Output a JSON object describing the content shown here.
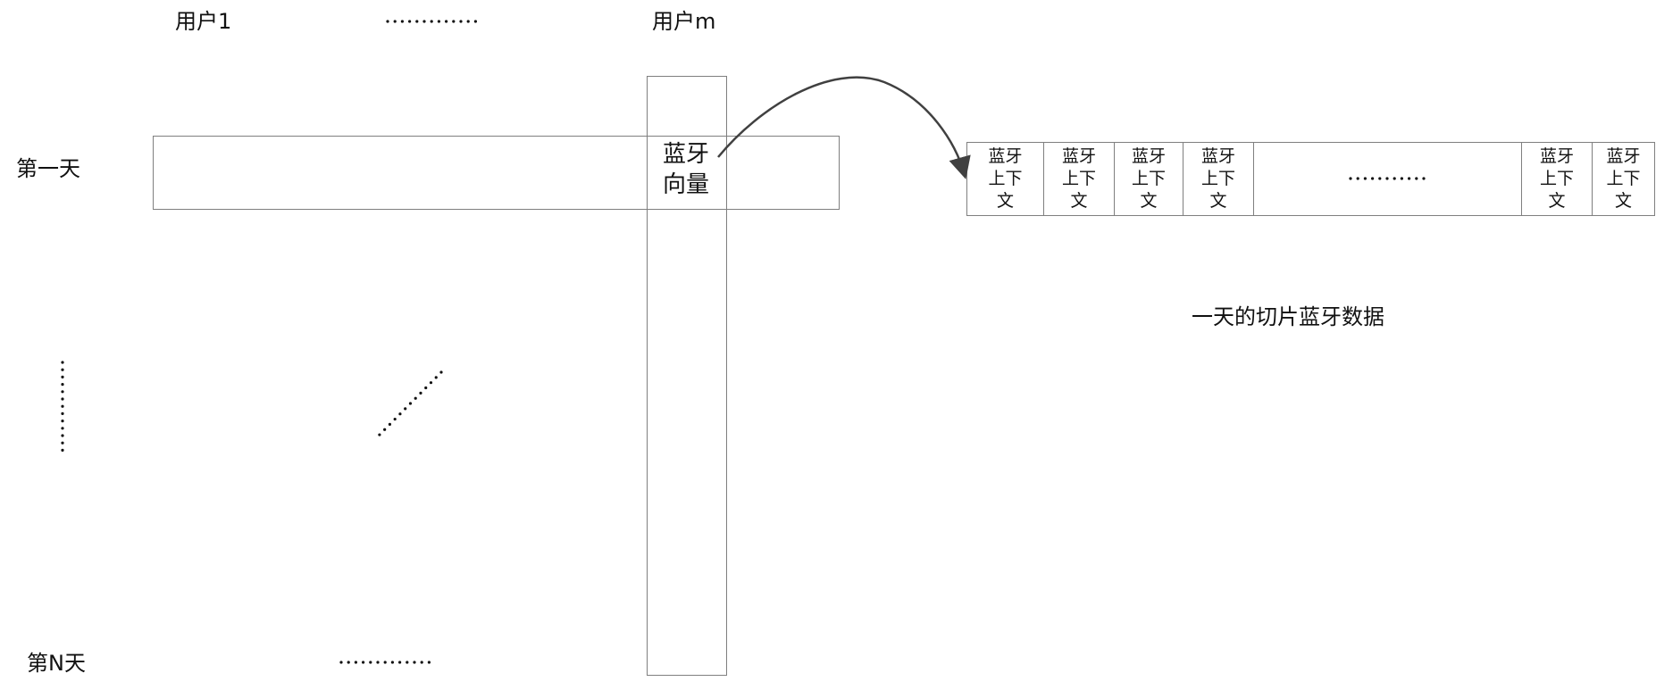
{
  "labels": {
    "user_first": "用户1",
    "user_last": "用户m",
    "day_first": "第一天",
    "day_last": "第N天",
    "caption": "一天的切片蓝牙数据"
  },
  "vector_cell": {
    "line1": "蓝牙",
    "line2": "向量"
  },
  "context_cells": [
    {
      "line1": "蓝牙",
      "line2": "上下",
      "line3": "文"
    },
    {
      "line1": "蓝牙",
      "line2": "上下",
      "line3": "文"
    },
    {
      "line1": "蓝牙",
      "line2": "上下",
      "line3": "文"
    },
    {
      "line1": "蓝牙",
      "line2": "上下",
      "line3": "文"
    },
    {
      "line1": "蓝牙",
      "line2": "上下",
      "line3": "文"
    },
    {
      "line1": "蓝牙",
      "line2": "上下",
      "line3": "文"
    }
  ]
}
